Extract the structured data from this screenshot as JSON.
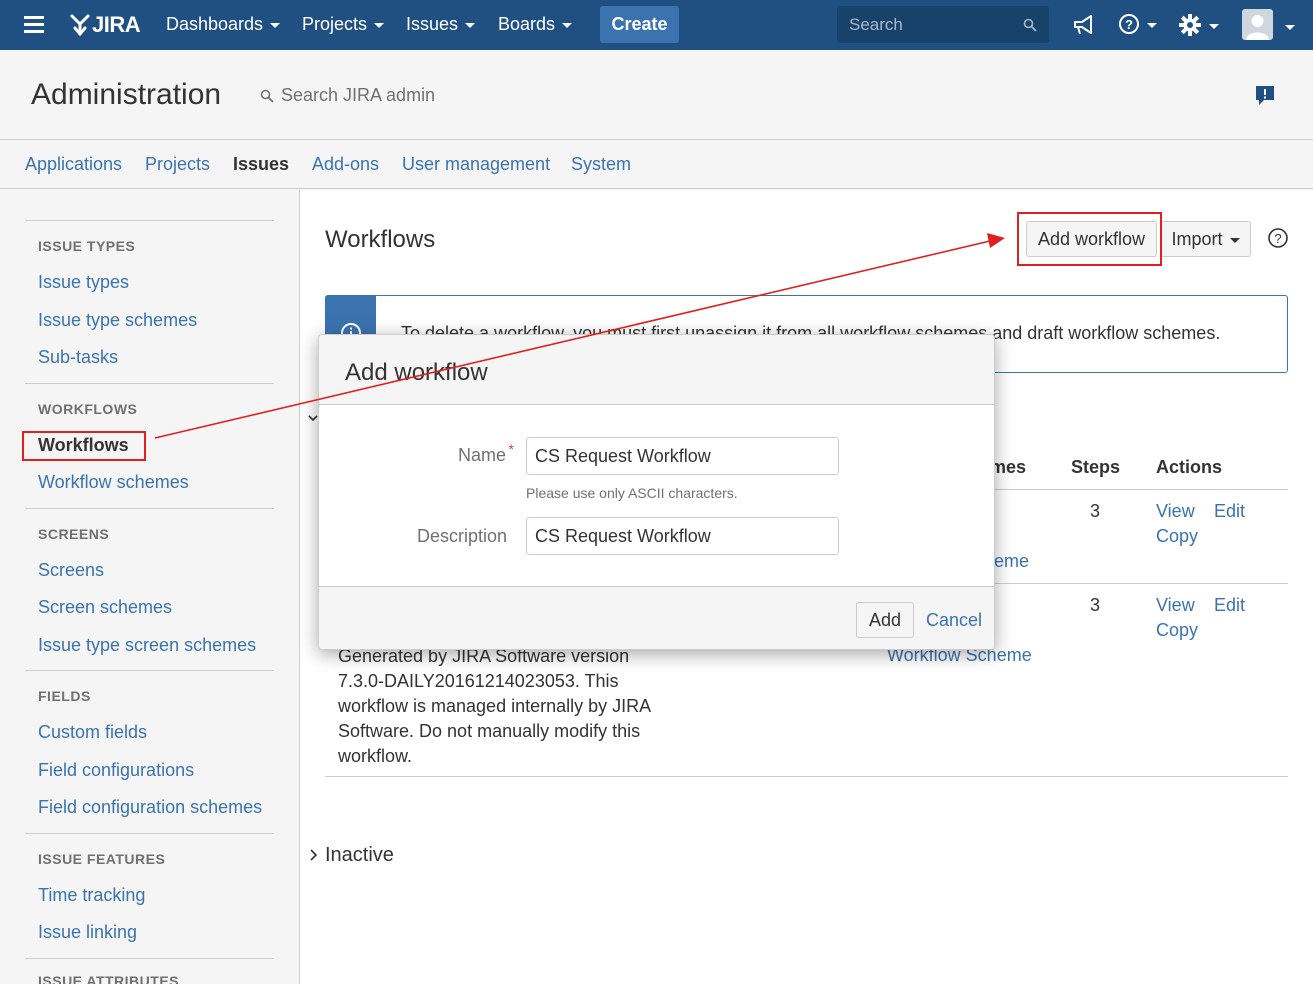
{
  "topnav": {
    "logo": "JIRA",
    "items": [
      {
        "label": "Dashboards"
      },
      {
        "label": "Projects"
      },
      {
        "label": "Issues"
      },
      {
        "label": "Boards"
      }
    ],
    "create_label": "Create",
    "search_placeholder": "Search",
    "icons": [
      "menu-icon",
      "megaphone-icon",
      "help-icon",
      "gear-icon",
      "avatar"
    ]
  },
  "admin": {
    "title": "Administration",
    "search_label": "Search JIRA admin"
  },
  "tabs": [
    {
      "label": "Applications"
    },
    {
      "label": "Projects"
    },
    {
      "label": "Issues",
      "active": true
    },
    {
      "label": "Add-ons"
    },
    {
      "label": "User management"
    },
    {
      "label": "System"
    }
  ],
  "sidebar": {
    "sections": [
      {
        "heading": "ISSUE TYPES",
        "items": [
          "Issue types",
          "Issue type schemes",
          "Sub-tasks"
        ]
      },
      {
        "heading": "WORKFLOWS",
        "items": [
          "Workflows",
          "Workflow schemes"
        ]
      },
      {
        "heading": "SCREENS",
        "items": [
          "Screens",
          "Screen schemes",
          "Issue type screen schemes"
        ]
      },
      {
        "heading": "FIELDS",
        "items": [
          "Custom fields",
          "Field configurations",
          "Field configuration schemes"
        ]
      },
      {
        "heading": "ISSUE FEATURES",
        "items": [
          "Time tracking",
          "Issue linking"
        ]
      },
      {
        "heading": "ISSUE ATTRIBUTES",
        "items": []
      }
    ],
    "active_item": "Workflows"
  },
  "main": {
    "title": "Workflows",
    "add_workflow_label": "Add workflow",
    "import_label": "Import",
    "info_text": "To delete a workflow, you must first unassign it from all workflow schemes and draft workflow schemes.",
    "table": {
      "headers": {
        "schemes": "mes",
        "steps": "Steps",
        "actions": "Actions"
      },
      "rows": [
        {
          "scheme": "eme",
          "steps": "3",
          "actions": [
            "View",
            "Edit",
            "Copy"
          ]
        },
        {
          "scheme": "Workflow Scheme",
          "steps": "3",
          "actions": [
            "View",
            "Edit",
            "Copy"
          ],
          "description": "Generated by JIRA Software version 7.3.0-DAILY20161214023053. This workflow is managed internally by JIRA Software. Do not manually modify this workflow."
        }
      ]
    },
    "inactive_label": "Inactive"
  },
  "dialog": {
    "title": "Add workflow",
    "name_label": "Name",
    "name_value": "CS Request Workflow",
    "name_hint": "Please use only ASCII characters.",
    "description_label": "Description",
    "description_value": "CS Request Workflow",
    "add_label": "Add",
    "cancel_label": "Cancel"
  },
  "colors": {
    "nav_bg": "#205081",
    "link": "#3b73af",
    "annotation": "#e02020",
    "required": "#d04437"
  }
}
